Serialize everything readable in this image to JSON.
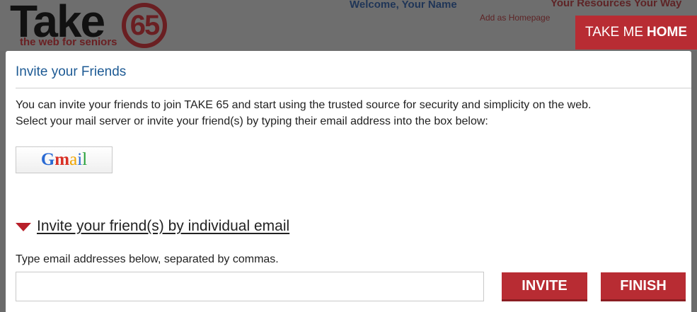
{
  "header": {
    "logo_word": "Take",
    "logo_number": "65",
    "logo_tagline": "the web for seniors",
    "welcome": "Welcome, Your Name",
    "resources": "Your Resources Your Way",
    "homepage_link": "Add as Homepage",
    "take_me_home_prefix": "TAKE ME",
    "take_me_home_bold": "HOME"
  },
  "dialog": {
    "title": "Invite your Friends",
    "intro_line1": "You can invite your friends to join TAKE 65 and start using the trusted source for security and simplicity on the web.",
    "intro_line2": "Select your mail server or invite your friend(s) by typing their email address into the box below:",
    "gmail_icon": "gmail-logo",
    "section_title": "Invite your friend(s) by individual email",
    "hint": "Type email addresses below, separated by commas.",
    "email_value": "",
    "email_placeholder": "",
    "invite_label": "INVITE",
    "finish_label": "FINISH"
  },
  "colors": {
    "brand_red": "#b82c33",
    "title_blue": "#1d5a94",
    "overlay_gray": "#6b6b6b"
  }
}
